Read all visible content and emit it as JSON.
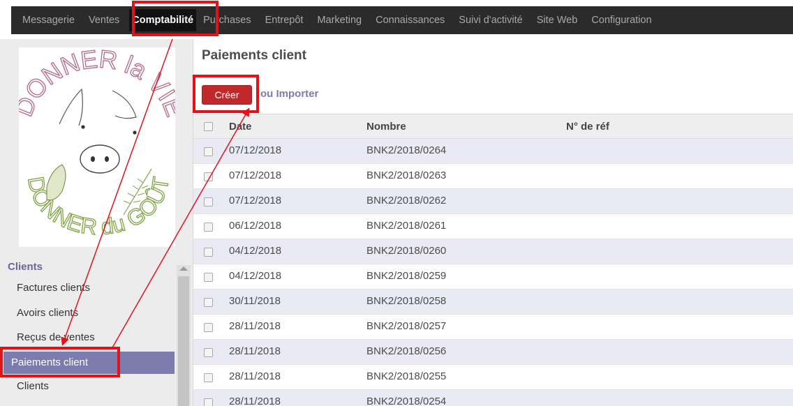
{
  "topbar": {
    "items": [
      "Messagerie",
      "Ventes",
      "Comptabilité",
      "Purchases",
      "Entrepôt",
      "Marketing",
      "Connaissances",
      "Suivi d'activité",
      "Site Web",
      "Configuration"
    ],
    "active_index": 2
  },
  "sidebar": {
    "section_title": "Clients",
    "items": [
      "Factures clients",
      "Avoirs clients",
      "Reçus de ventes",
      "Paiements client",
      "Clients"
    ],
    "active_index": 3,
    "logo_text": [
      "DONNER la VIE",
      "DONNER du GOÛT"
    ]
  },
  "main": {
    "title": "Paiements client",
    "create_label": "Créer",
    "import_label": "ou Importer",
    "columns": [
      "Date",
      "Nombre",
      "N° de réf"
    ],
    "rows": [
      {
        "date": "07/12/2018",
        "number": "BNK2/2018/0264",
        "ref": ""
      },
      {
        "date": "07/12/2018",
        "number": "BNK2/2018/0263",
        "ref": ""
      },
      {
        "date": "07/12/2018",
        "number": "BNK2/2018/0262",
        "ref": ""
      },
      {
        "date": "06/12/2018",
        "number": "BNK2/2018/0261",
        "ref": ""
      },
      {
        "date": "04/12/2018",
        "number": "BNK2/2018/0260",
        "ref": ""
      },
      {
        "date": "04/12/2018",
        "number": "BNK2/2018/0259",
        "ref": ""
      },
      {
        "date": "30/11/2018",
        "number": "BNK2/2018/0258",
        "ref": ""
      },
      {
        "date": "28/11/2018",
        "number": "BNK2/2018/0257",
        "ref": ""
      },
      {
        "date": "28/11/2018",
        "number": "BNK2/2018/0256",
        "ref": ""
      },
      {
        "date": "28/11/2018",
        "number": "BNK2/2018/0255",
        "ref": ""
      },
      {
        "date": "28/11/2018",
        "number": "BNK2/2018/0254",
        "ref": ""
      }
    ]
  },
  "colors": {
    "topbar_bg": "#2b2b2b",
    "accent_purple": "#7c7bad",
    "create_red": "#c0282b",
    "annotation_red": "#e3121a",
    "row_stripe": "#eaeaf4"
  }
}
